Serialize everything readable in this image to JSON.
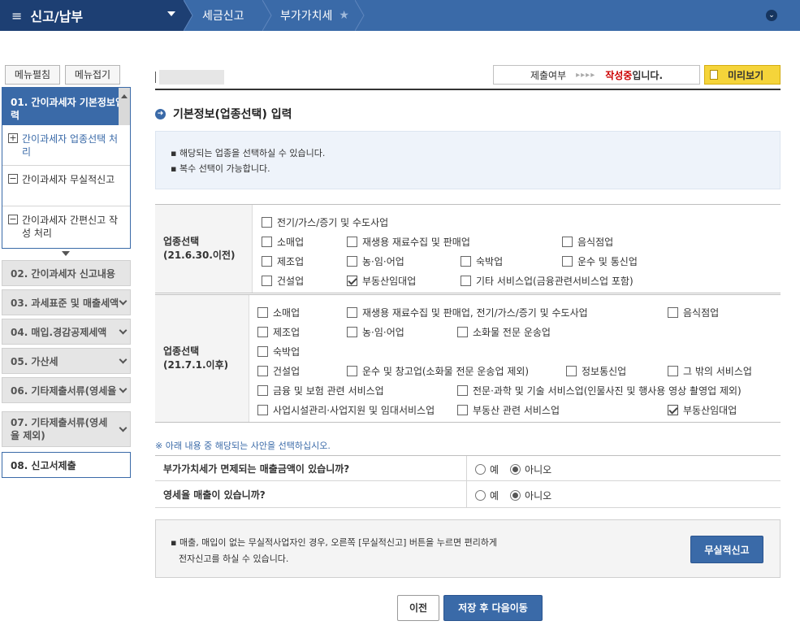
{
  "topbar": {
    "menu_title": "신고/납부",
    "crumbs": [
      "세금신고",
      "부가가치세"
    ]
  },
  "sidebar": {
    "edit_label": "메뉴펼침",
    "collapse_label": "메뉴접기",
    "open_section": "01. 간이과세자 기본정보입력",
    "subitems": [
      {
        "label": "간이과세자 업종선택 처리",
        "mark": "+"
      },
      {
        "label": "간이과세자 무실적신고",
        "mark": "−"
      },
      {
        "label": "간이과세자 간편신고 작성 처리",
        "mark": "−"
      }
    ],
    "items": [
      {
        "label": "02. 간이과세자 신고내용"
      },
      {
        "label": "03. 과세표준 및 매출세액"
      },
      {
        "label": "04. 매입.경감공제세액"
      },
      {
        "label": "05. 가산세"
      },
      {
        "label": "06. 기타제출서류(영세율"
      },
      {
        "label": "07. 기타제출서류(영세율 제외)"
      },
      {
        "label": "08. 신고서제출"
      }
    ]
  },
  "status": {
    "label": "제출여부",
    "arrows": "▸▸▸▸",
    "state": "작성중",
    "suffix": "입니다."
  },
  "preview_label": "미리보기",
  "section_title": "기본정보(업종선택) 입력",
  "info_lines": [
    "해당되는 업종을 선택하실 수 있습니다.",
    "복수 선택이 가능합니다."
  ],
  "table1": {
    "label_line1": "업종선택",
    "label_line2": "(21.6.30.이전)",
    "options": [
      {
        "label": "전기/가스/증기 및 수도사업",
        "checked": false
      },
      {
        "label": "소매업",
        "checked": false
      },
      {
        "label": "재생용 재료수집 및 판매업",
        "checked": false
      },
      {
        "label": "음식점업",
        "checked": false
      },
      {
        "label": "제조업",
        "checked": false
      },
      {
        "label": "농·임·어업",
        "checked": false
      },
      {
        "label": "숙박업",
        "checked": false
      },
      {
        "label": "운수 및 통신업",
        "checked": false
      },
      {
        "label": "건설업",
        "checked": false
      },
      {
        "label": "부동산임대업",
        "checked": true
      },
      {
        "label": "기타 서비스업(금융관련서비스업 포함)",
        "checked": false
      }
    ]
  },
  "table2": {
    "label_line1": "업종선택",
    "label_line2": "(21.7.1.이후)",
    "options": [
      {
        "label": "소매업",
        "checked": false
      },
      {
        "label": "재생용 재료수집 및 판매업, 전기/가스/증기 및 수도사업",
        "checked": false
      },
      {
        "label": "음식점업",
        "checked": false
      },
      {
        "label": "제조업",
        "checked": false
      },
      {
        "label": "농·임·어업",
        "checked": false
      },
      {
        "label": "소화물 전문 운송업",
        "checked": false
      },
      {
        "label": "숙박업",
        "checked": false
      },
      {
        "label": "건설업",
        "checked": false
      },
      {
        "label": "운수 및 창고업(소화물 전문 운송업 제외)",
        "checked": false
      },
      {
        "label": "정보통신업",
        "checked": false
      },
      {
        "label": "그 밖의 서비스업",
        "checked": false
      },
      {
        "label": "금융 및 보험 관련 서비스업",
        "checked": false
      },
      {
        "label": "전문·과학 및 기술 서비스업(인물사진 및 행사용 영상 촬영업 제외)",
        "checked": false
      },
      {
        "label": "사업시설관리·사업지원 및 임대서비스업",
        "checked": false
      },
      {
        "label": "부동산 관련 서비스업",
        "checked": false
      },
      {
        "label": "부동산임대업",
        "checked": true
      }
    ]
  },
  "note": "※ 아래 내용 중 해당되는 사안을 선택하십시오.",
  "questions": [
    {
      "label": "부가가치세가 면제되는 매출금액이 있습니까?",
      "yes": "예",
      "no": "아니오",
      "selected": "no"
    },
    {
      "label": "영세율 매출이 있습니까?",
      "yes": "예",
      "no": "아니오",
      "selected": "no"
    }
  ],
  "nil_box": {
    "line1": "매출, 매입이 없는 무실적사업자인 경우, 오른쪽 [무실적신고] 버튼을 누르면 편리하게",
    "line2": "전자신고를 하실 수 있습니다.",
    "button": "무실적신고"
  },
  "buttons": {
    "prev": "이전",
    "next": "저장 후 다음이동"
  }
}
